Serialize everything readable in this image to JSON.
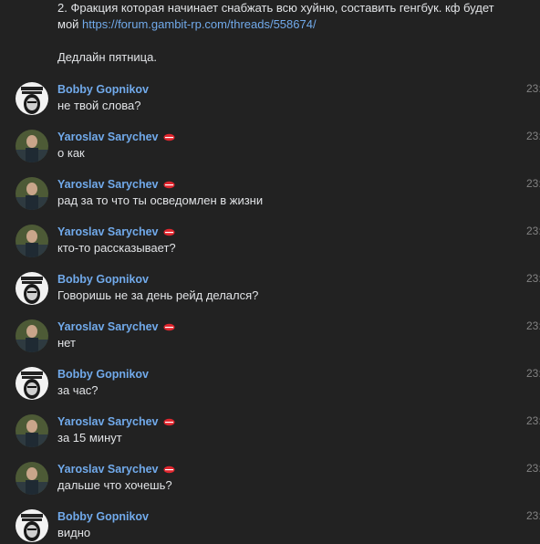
{
  "previous_message": {
    "line1": "2. Фракция которая начинает снабжать всю хуйню, составить генгбук. кф будет",
    "line2_prefix": "мой ",
    "link": "https://forum.gambit-rp.com/threads/558674/",
    "line3": "Дедлайн пятница."
  },
  "messages": [
    {
      "author": "Bobby Gopnikov",
      "text": "не твой слова?",
      "time": "23:"
    },
    {
      "author": "Yaroslav Sarychev",
      "text": "о как",
      "time": "23:"
    },
    {
      "author": "Yaroslav Sarychev",
      "text": "рад за то что ты осведомлен в жизни",
      "time": "23:"
    },
    {
      "author": "Yaroslav Sarychev",
      "text": "кто-то рассказывает?",
      "time": "23:"
    },
    {
      "author": "Bobby Gopnikov",
      "text": "Говоришь не за день рейд делался?",
      "time": "23:"
    },
    {
      "author": "Yaroslav Sarychev",
      "text": "нет",
      "time": "23:"
    },
    {
      "author": "Bobby Gopnikov",
      "text": "за час?",
      "time": "23:"
    },
    {
      "author": "Yaroslav Sarychev",
      "text": "за 15 минут",
      "time": "23:"
    },
    {
      "author": "Yaroslav Sarychev",
      "text": "дальше что хочешь?",
      "time": "23:"
    },
    {
      "author": "Bobby Gopnikov",
      "text": "видно",
      "time": "23:"
    }
  ],
  "colors": {
    "background": "#222222",
    "author": "#71aaeb",
    "text": "#e1e3e6",
    "time": "#828282",
    "badge": "#e0262e"
  }
}
